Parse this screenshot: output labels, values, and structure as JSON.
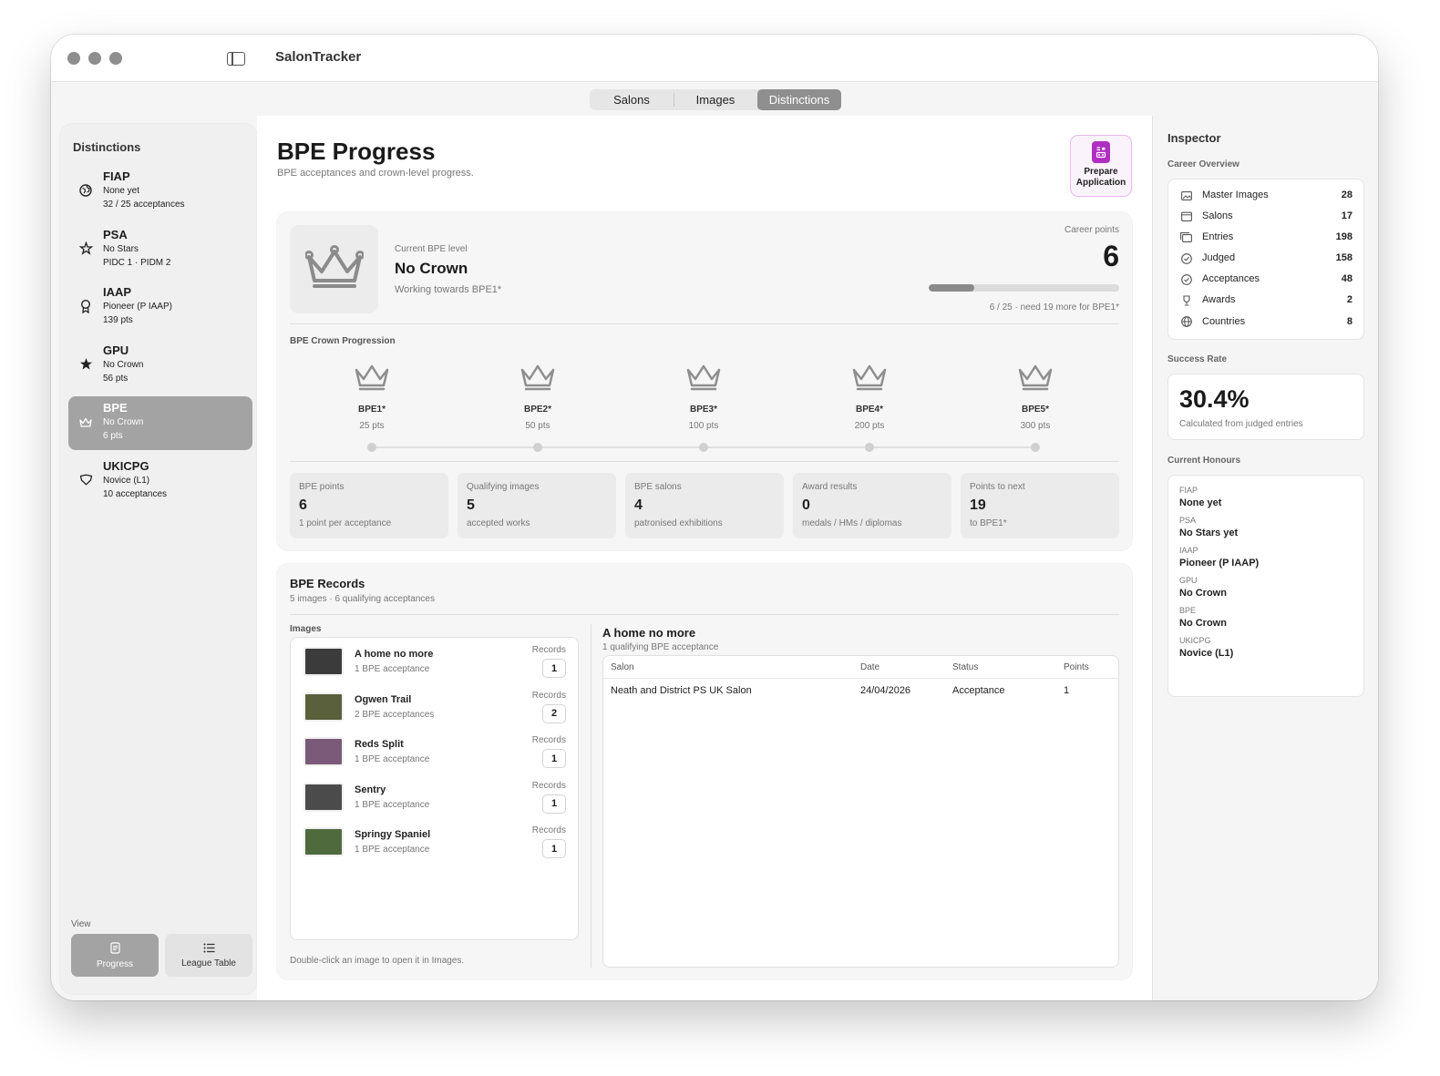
{
  "app": {
    "title": "SalonTracker"
  },
  "tabs": [
    {
      "label": "Salons",
      "active": false
    },
    {
      "label": "Images",
      "active": false
    },
    {
      "label": "Distinctions",
      "active": true
    }
  ],
  "sidebar": {
    "heading": "Distinctions",
    "items": [
      {
        "name": "FIAP",
        "line1": "None yet",
        "line2": "32 / 25 acceptances",
        "icon": "globe-icon",
        "active": false
      },
      {
        "name": "PSA",
        "line1": "No Stars",
        "line2": "PIDC 1 · PIDM 2",
        "icon": "star-sparkle-icon",
        "active": false
      },
      {
        "name": "IAAP",
        "line1": "Pioneer (P IAAP)",
        "line2": "139 pts",
        "icon": "rosette-icon",
        "active": false
      },
      {
        "name": "GPU",
        "line1": "No Crown",
        "line2": "56 pts",
        "icon": "star-icon",
        "active": false
      },
      {
        "name": "BPE",
        "line1": "No Crown",
        "line2": "6 pts",
        "icon": "crown-icon",
        "active": true
      },
      {
        "name": "UKICPG",
        "line1": "Novice (L1)",
        "line2": "10 acceptances",
        "icon": "shield-icon",
        "active": false
      }
    ],
    "view_label": "View",
    "view_buttons": [
      {
        "label": "Progress",
        "icon": "document-icon",
        "active": true
      },
      {
        "label": "League Table",
        "icon": "list-icon",
        "active": false
      }
    ]
  },
  "main": {
    "title": "BPE Progress",
    "subtitle": "BPE acceptances and crown-level progress.",
    "prepare_button": "Prepare Application",
    "level": {
      "label": "Current BPE level",
      "value": "No Crown",
      "towards": "Working towards BPE1*"
    },
    "career": {
      "label": "Career points",
      "value": "6",
      "progress_fraction": 0.24,
      "note": "6 / 25 · need 19 more for BPE1*"
    },
    "crown_progression_label": "BPE Crown Progression",
    "crowns": [
      {
        "name": "BPE1*",
        "pts": "25 pts"
      },
      {
        "name": "BPE2*",
        "pts": "50 pts"
      },
      {
        "name": "BPE3*",
        "pts": "100 pts"
      },
      {
        "name": "BPE4*",
        "pts": "200 pts"
      },
      {
        "name": "BPE5*",
        "pts": "300 pts"
      }
    ],
    "stats": [
      {
        "label": "BPE points",
        "value": "6",
        "note": "1 point per acceptance"
      },
      {
        "label": "Qualifying images",
        "value": "5",
        "note": "accepted works"
      },
      {
        "label": "BPE salons",
        "value": "4",
        "note": "patronised exhibitions"
      },
      {
        "label": "Award results",
        "value": "0",
        "note": "medals / HMs / diplomas"
      },
      {
        "label": "Points to next",
        "value": "19",
        "note": "to BPE1*"
      }
    ],
    "records": {
      "title": "BPE Records",
      "subtitle": "5 images · 6 qualifying acceptances",
      "images_label": "Images",
      "records_label": "Records",
      "images": [
        {
          "name": "A home no more",
          "sub": "1 BPE acceptance",
          "count": "1",
          "thumb_color": "#3b3b3b"
        },
        {
          "name": "Ogwen Trail",
          "sub": "2 BPE acceptances",
          "count": "2",
          "thumb_color": "#5a5f3c"
        },
        {
          "name": "Reds Split",
          "sub": "1 BPE acceptance",
          "count": "1",
          "thumb_color": "#7a5a78"
        },
        {
          "name": "Sentry",
          "sub": "1 BPE acceptance",
          "count": "1",
          "thumb_color": "#4b4b4b"
        },
        {
          "name": "Springy Spaniel",
          "sub": "1 BPE acceptance",
          "count": "1",
          "thumb_color": "#4f6a3c"
        }
      ],
      "hint": "Double-click an image to open it in Images.",
      "detail": {
        "title": "A home no more",
        "subtitle": "1 qualifying BPE acceptance",
        "columns": [
          "Salon",
          "Date",
          "Status",
          "Points"
        ],
        "rows": [
          [
            "Neath and District PS UK Salon",
            "24/04/2026",
            "Acceptance",
            "1"
          ]
        ]
      }
    }
  },
  "inspector": {
    "title": "Inspector",
    "career_overview_label": "Career Overview",
    "overview": [
      {
        "label": "Master Images",
        "value": "28",
        "icon": "photo-icon"
      },
      {
        "label": "Salons",
        "value": "17",
        "icon": "calendar-icon"
      },
      {
        "label": "Entries",
        "value": "198",
        "icon": "photos-stack-icon"
      },
      {
        "label": "Judged",
        "value": "158",
        "icon": "check-circle-icon"
      },
      {
        "label": "Acceptances",
        "value": "48",
        "icon": "check-circle-icon"
      },
      {
        "label": "Awards",
        "value": "2",
        "icon": "trophy-icon"
      },
      {
        "label": "Countries",
        "value": "8",
        "icon": "globe-icon"
      }
    ],
    "success_label": "Success Rate",
    "success_value": "30.4%",
    "success_note": "Calculated from judged entries",
    "honours_label": "Current Honours",
    "honours": [
      {
        "name": "FIAP",
        "value": "None yet"
      },
      {
        "name": "PSA",
        "value": "No Stars yet"
      },
      {
        "name": "IAAP",
        "value": "Pioneer (P IAAP)"
      },
      {
        "name": "GPU",
        "value": "No Crown"
      },
      {
        "name": "BPE",
        "value": "No Crown"
      },
      {
        "name": "UKICPG",
        "value": "Novice (L1)"
      }
    ]
  }
}
